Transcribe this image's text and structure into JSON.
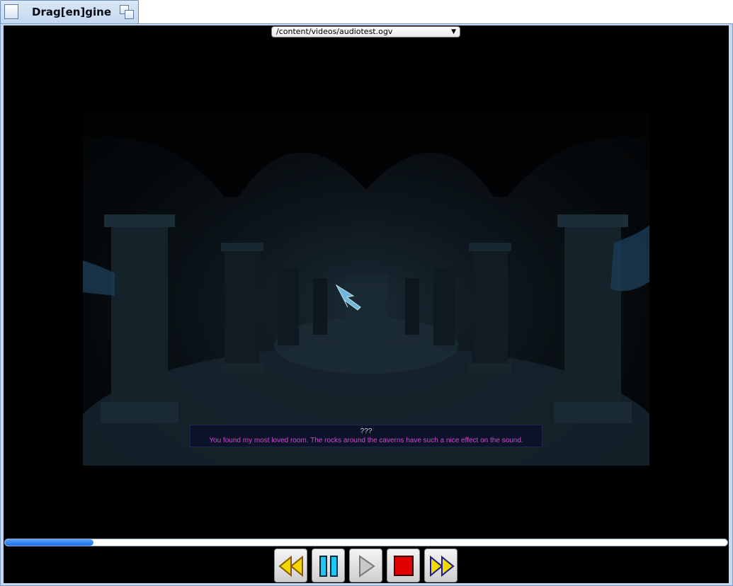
{
  "window": {
    "title": "Drag[en]gine"
  },
  "player": {
    "file_select_value": "/content/videos/audiotest.ogv",
    "progress_fraction": 0.123,
    "subtitle": {
      "speaker": "???",
      "text": "You found my most loved room. The rocks around the caverns have such a nice effect on the sound."
    },
    "controls": [
      "rewind",
      "pause",
      "play",
      "stop",
      "fast-forward"
    ]
  },
  "colors": {
    "subtitle_text": "#d347d3",
    "progress_fill": "#1a6fe8",
    "stop_button": "#e00000",
    "pause_button": "#1ec8f0",
    "seek_buttons": "#f0d800"
  }
}
